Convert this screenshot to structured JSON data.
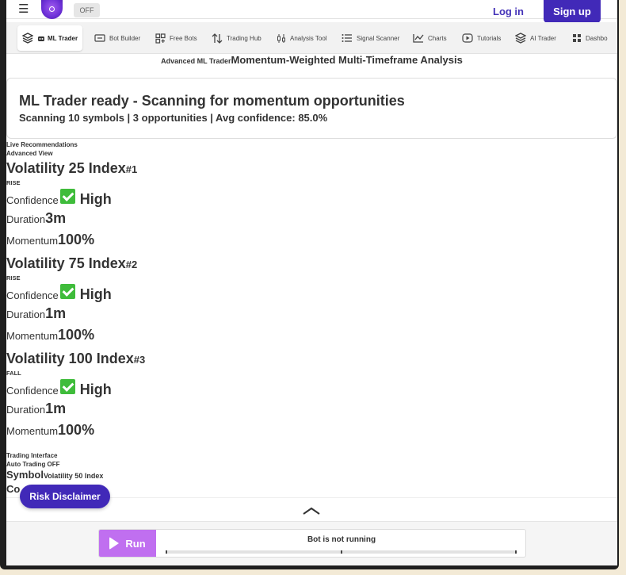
{
  "header": {
    "toggle_label": "OFF",
    "login_label": "Log in",
    "signup_label": "Sign up"
  },
  "nav": {
    "items": [
      {
        "label": "ML Trader",
        "icon": "layers-icon",
        "active": true
      },
      {
        "label": "Bot Builder",
        "icon": "bot-builder-icon"
      },
      {
        "label": "Free Bots",
        "icon": "free-bots-icon"
      },
      {
        "label": "Trading Hub",
        "icon": "trading-hub-icon"
      },
      {
        "label": "Analysis Tool",
        "icon": "analysis-tool-icon"
      },
      {
        "label": "Signal Scanner",
        "icon": "list-icon"
      },
      {
        "label": "Charts",
        "icon": "chart-icon"
      },
      {
        "label": "Tutorials",
        "icon": "play-icon"
      },
      {
        "label": "AI Trader",
        "icon": "layers-icon"
      },
      {
        "label": "Dashbo",
        "icon": "dashboard-icon"
      }
    ]
  },
  "page": {
    "title_small": "Advanced ML Trader",
    "title_main": "Momentum-Weighted Multi-Timeframe Analysis"
  },
  "status": {
    "title": "ML Trader ready - Scanning for momentum opportunities",
    "subtitle": "Scanning 10 symbols | 3 opportunities | Avg confidence: 85.0%"
  },
  "recommendations": {
    "heading": "Live Recommendations",
    "view": "Advanced View",
    "confidence_label": "Confidence",
    "duration_label": "Duration",
    "momentum_label": "Momentum",
    "items": [
      {
        "symbol": "Volatility 25 Index",
        "rank": "#1",
        "direction": "RISE",
        "confidence": "High",
        "duration": "3m",
        "momentum": "100%"
      },
      {
        "symbol": "Volatility 75 Index",
        "rank": "#2",
        "direction": "RISE",
        "confidence": "High",
        "duration": "1m",
        "momentum": "100%"
      },
      {
        "symbol": "Volatility 100 Index",
        "rank": "#3",
        "direction": "FALL",
        "confidence": "High",
        "duration": "1m",
        "momentum": "100%"
      }
    ]
  },
  "trading": {
    "heading": "Trading Interface",
    "auto": "Auto Trading OFF",
    "symbol_label": "Symbol",
    "symbol_value": "Volatility 50 Index",
    "next_label": "Co"
  },
  "disclaimer_label": "Risk Disclaimer",
  "runbar": {
    "run_label": "Run",
    "status": "Bot is not running"
  }
}
